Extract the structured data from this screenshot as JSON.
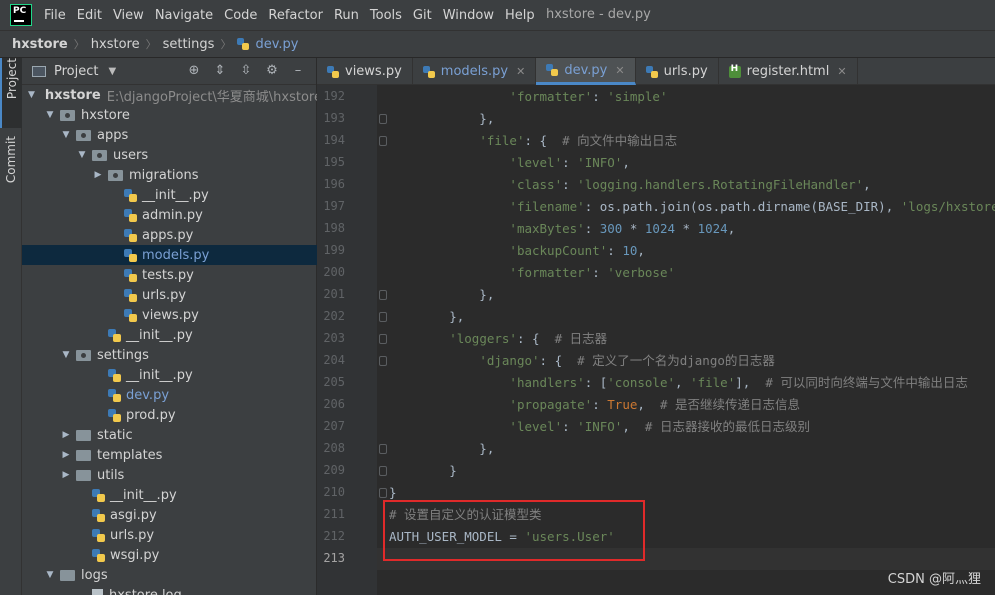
{
  "menubar": {
    "logo_text": "PC",
    "items": [
      "File",
      "Edit",
      "View",
      "Navigate",
      "Code",
      "Refactor",
      "Run",
      "Tools",
      "Git",
      "Window",
      "Help"
    ],
    "window_title": "hxstore - dev.py"
  },
  "breadcrumb": [
    "hxstore",
    "hxstore",
    "settings",
    "dev.py"
  ],
  "toolstrip": {
    "project": "Project",
    "commit": "Commit"
  },
  "project_panel": {
    "title": "Project",
    "tree": [
      {
        "label": "hxstore",
        "hint": "E:\\djangoProject\\华夏商城\\hxstore",
        "type": "folder",
        "depth": 0,
        "open": true,
        "bold": true
      },
      {
        "label": "hxstore",
        "type": "pkg",
        "depth": 1,
        "open": true
      },
      {
        "label": "apps",
        "type": "pkg",
        "depth": 2,
        "open": true
      },
      {
        "label": "users",
        "type": "pkg",
        "depth": 3,
        "open": true
      },
      {
        "label": "migrations",
        "type": "pkg",
        "depth": 4,
        "open": false
      },
      {
        "label": "__init__.py",
        "type": "py",
        "depth": 5
      },
      {
        "label": "admin.py",
        "type": "py",
        "depth": 5
      },
      {
        "label": "apps.py",
        "type": "py",
        "depth": 5
      },
      {
        "label": "models.py",
        "type": "py",
        "depth": 5,
        "selected": true,
        "blue": true
      },
      {
        "label": "tests.py",
        "type": "py",
        "depth": 5
      },
      {
        "label": "urls.py",
        "type": "py",
        "depth": 5
      },
      {
        "label": "views.py",
        "type": "py",
        "depth": 5
      },
      {
        "label": "__init__.py",
        "type": "py",
        "depth": 4
      },
      {
        "label": "settings",
        "type": "pkg",
        "depth": 2,
        "open": true
      },
      {
        "label": "__init__.py",
        "type": "py",
        "depth": 4
      },
      {
        "label": "dev.py",
        "type": "py",
        "depth": 4,
        "blue": true
      },
      {
        "label": "prod.py",
        "type": "py",
        "depth": 4
      },
      {
        "label": "static",
        "type": "folder",
        "depth": 2,
        "open": false
      },
      {
        "label": "templates",
        "type": "folder",
        "depth": 2,
        "open": false
      },
      {
        "label": "utils",
        "type": "folder",
        "depth": 2,
        "open": false
      },
      {
        "label": "__init__.py",
        "type": "py",
        "depth": 3
      },
      {
        "label": "asgi.py",
        "type": "py",
        "depth": 3
      },
      {
        "label": "urls.py",
        "type": "py",
        "depth": 3
      },
      {
        "label": "wsgi.py",
        "type": "py",
        "depth": 3
      },
      {
        "label": "logs",
        "type": "folder",
        "depth": 1,
        "open": true
      },
      {
        "label": "hxstore.log",
        "type": "log",
        "depth": 3
      }
    ]
  },
  "tabs": [
    {
      "label": "views.py",
      "icon": "python-file-icon",
      "active": false,
      "blue": false,
      "closable": false
    },
    {
      "label": "models.py",
      "icon": "python-file-icon",
      "active": false,
      "blue": true,
      "closable": true
    },
    {
      "label": "dev.py",
      "icon": "python-file-icon",
      "active": true,
      "blue": true,
      "closable": true
    },
    {
      "label": "urls.py",
      "icon": "python-file-icon",
      "active": false,
      "blue": false,
      "closable": false
    },
    {
      "label": "register.html",
      "icon": "html-file-icon",
      "active": false,
      "blue": false,
      "closable": true
    }
  ],
  "editor": {
    "current_line": 213,
    "lines": [
      {
        "n": 192,
        "tokens": [
          [
            "p",
            "                "
          ],
          [
            "s",
            "'formatter'"
          ],
          [
            "p",
            ": "
          ],
          [
            "s",
            "'simple'"
          ]
        ]
      },
      {
        "n": 193,
        "tokens": [
          [
            "p",
            "            },"
          ]
        ]
      },
      {
        "n": 194,
        "tokens": [
          [
            "p",
            "            "
          ],
          [
            "s",
            "'file'"
          ],
          [
            "p",
            ": {  "
          ],
          [
            "c",
            "# 向文件中输出日志"
          ]
        ]
      },
      {
        "n": 195,
        "tokens": [
          [
            "p",
            "                "
          ],
          [
            "s",
            "'level'"
          ],
          [
            "p",
            ": "
          ],
          [
            "s",
            "'INFO'"
          ],
          [
            "p",
            ","
          ]
        ]
      },
      {
        "n": 196,
        "tokens": [
          [
            "p",
            "                "
          ],
          [
            "s",
            "'class'"
          ],
          [
            "p",
            ": "
          ],
          [
            "s",
            "'logging.handlers.RotatingFileHandler'"
          ],
          [
            "p",
            ","
          ]
        ]
      },
      {
        "n": 197,
        "tokens": [
          [
            "p",
            "                "
          ],
          [
            "s",
            "'filename'"
          ],
          [
            "p",
            ": os.path.join(os.path.dirname(BASE_DIR), "
          ],
          [
            "s",
            "'logs/hxstore"
          ]
        ]
      },
      {
        "n": 198,
        "tokens": [
          [
            "p",
            "                "
          ],
          [
            "s",
            "'maxBytes'"
          ],
          [
            "p",
            ": "
          ],
          [
            "n",
            "300"
          ],
          [
            "p",
            " * "
          ],
          [
            "n",
            "1024"
          ],
          [
            "p",
            " * "
          ],
          [
            "n",
            "1024"
          ],
          [
            "p",
            ","
          ]
        ]
      },
      {
        "n": 199,
        "tokens": [
          [
            "p",
            "                "
          ],
          [
            "s",
            "'backupCount'"
          ],
          [
            "p",
            ": "
          ],
          [
            "n",
            "10"
          ],
          [
            "p",
            ","
          ]
        ]
      },
      {
        "n": 200,
        "tokens": [
          [
            "p",
            "                "
          ],
          [
            "s",
            "'formatter'"
          ],
          [
            "p",
            ": "
          ],
          [
            "s",
            "'verbose'"
          ]
        ]
      },
      {
        "n": 201,
        "tokens": [
          [
            "p",
            "            },"
          ]
        ]
      },
      {
        "n": 202,
        "tokens": [
          [
            "p",
            "        },"
          ]
        ]
      },
      {
        "n": 203,
        "tokens": [
          [
            "p",
            "        "
          ],
          [
            "s",
            "'loggers'"
          ],
          [
            "p",
            ": {  "
          ],
          [
            "c",
            "# 日志器"
          ]
        ]
      },
      {
        "n": 204,
        "tokens": [
          [
            "p",
            "            "
          ],
          [
            "s",
            "'django'"
          ],
          [
            "p",
            ": {  "
          ],
          [
            "c",
            "# 定义了一个名为django的日志器"
          ]
        ]
      },
      {
        "n": 205,
        "tokens": [
          [
            "p",
            "                "
          ],
          [
            "s",
            "'handlers'"
          ],
          [
            "p",
            ": ["
          ],
          [
            "s",
            "'console'"
          ],
          [
            "p",
            ", "
          ],
          [
            "s",
            "'file'"
          ],
          [
            "p",
            "],  "
          ],
          [
            "c",
            "# 可以同时向终端与文件中输出日志"
          ]
        ]
      },
      {
        "n": 206,
        "tokens": [
          [
            "p",
            "                "
          ],
          [
            "s",
            "'propagate'"
          ],
          [
            "p",
            ": "
          ],
          [
            "k",
            "True"
          ],
          [
            "p",
            ",  "
          ],
          [
            "c",
            "# 是否继续传递日志信息"
          ]
        ]
      },
      {
        "n": 207,
        "tokens": [
          [
            "p",
            "                "
          ],
          [
            "s",
            "'level'"
          ],
          [
            "p",
            ": "
          ],
          [
            "s",
            "'INFO'"
          ],
          [
            "p",
            ",  "
          ],
          [
            "c",
            "# 日志器接收的最低日志级别"
          ]
        ]
      },
      {
        "n": 208,
        "tokens": [
          [
            "p",
            "            },"
          ]
        ]
      },
      {
        "n": 209,
        "tokens": [
          [
            "p",
            "        }"
          ]
        ]
      },
      {
        "n": 210,
        "tokens": [
          [
            "p",
            "}"
          ]
        ]
      },
      {
        "n": 211,
        "tokens": [
          [
            "c",
            "# 设置自定义的认证模型类"
          ]
        ]
      },
      {
        "n": 212,
        "tokens": [
          [
            "p",
            "AUTH_USER_MODEL = "
          ],
          [
            "s",
            "'users.User'"
          ]
        ]
      },
      {
        "n": 213,
        "tokens": [
          [
            "p",
            ""
          ]
        ]
      }
    ],
    "fold_lines": [
      193,
      194,
      201,
      202,
      203,
      204,
      208,
      209,
      210
    ]
  },
  "watermark": "CSDN @阿灬狸"
}
